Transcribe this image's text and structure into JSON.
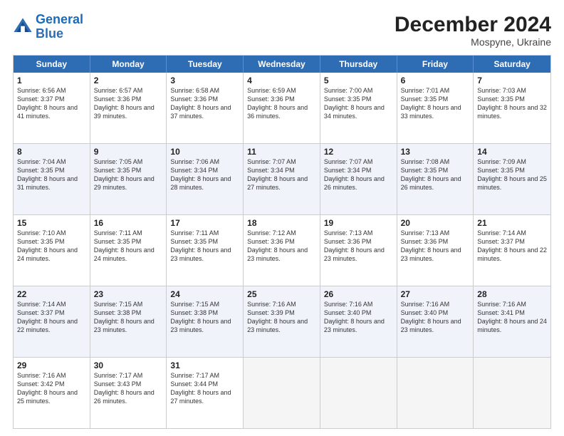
{
  "header": {
    "logo_line1": "General",
    "logo_line2": "Blue",
    "month_year": "December 2024",
    "location": "Mospyne, Ukraine"
  },
  "weekdays": [
    "Sunday",
    "Monday",
    "Tuesday",
    "Wednesday",
    "Thursday",
    "Friday",
    "Saturday"
  ],
  "weeks": [
    [
      {
        "day": "1",
        "rise": "6:56 AM",
        "set": "3:37 PM",
        "daylight": "8 hours and 41 minutes.",
        "alt": false,
        "empty": false
      },
      {
        "day": "2",
        "rise": "6:57 AM",
        "set": "3:36 PM",
        "daylight": "8 hours and 39 minutes.",
        "alt": false,
        "empty": false
      },
      {
        "day": "3",
        "rise": "6:58 AM",
        "set": "3:36 PM",
        "daylight": "8 hours and 37 minutes.",
        "alt": false,
        "empty": false
      },
      {
        "day": "4",
        "rise": "6:59 AM",
        "set": "3:36 PM",
        "daylight": "8 hours and 36 minutes.",
        "alt": false,
        "empty": false
      },
      {
        "day": "5",
        "rise": "7:00 AM",
        "set": "3:35 PM",
        "daylight": "8 hours and 34 minutes.",
        "alt": false,
        "empty": false
      },
      {
        "day": "6",
        "rise": "7:01 AM",
        "set": "3:35 PM",
        "daylight": "8 hours and 33 minutes.",
        "alt": false,
        "empty": false
      },
      {
        "day": "7",
        "rise": "7:03 AM",
        "set": "3:35 PM",
        "daylight": "8 hours and 32 minutes.",
        "alt": false,
        "empty": false
      }
    ],
    [
      {
        "day": "8",
        "rise": "7:04 AM",
        "set": "3:35 PM",
        "daylight": "8 hours and 31 minutes.",
        "alt": true,
        "empty": false
      },
      {
        "day": "9",
        "rise": "7:05 AM",
        "set": "3:35 PM",
        "daylight": "8 hours and 29 minutes.",
        "alt": true,
        "empty": false
      },
      {
        "day": "10",
        "rise": "7:06 AM",
        "set": "3:34 PM",
        "daylight": "8 hours and 28 minutes.",
        "alt": true,
        "empty": false
      },
      {
        "day": "11",
        "rise": "7:07 AM",
        "set": "3:34 PM",
        "daylight": "8 hours and 27 minutes.",
        "alt": true,
        "empty": false
      },
      {
        "day": "12",
        "rise": "7:07 AM",
        "set": "3:34 PM",
        "daylight": "8 hours and 26 minutes.",
        "alt": true,
        "empty": false
      },
      {
        "day": "13",
        "rise": "7:08 AM",
        "set": "3:35 PM",
        "daylight": "8 hours and 26 minutes.",
        "alt": true,
        "empty": false
      },
      {
        "day": "14",
        "rise": "7:09 AM",
        "set": "3:35 PM",
        "daylight": "8 hours and 25 minutes.",
        "alt": true,
        "empty": false
      }
    ],
    [
      {
        "day": "15",
        "rise": "7:10 AM",
        "set": "3:35 PM",
        "daylight": "8 hours and 24 minutes.",
        "alt": false,
        "empty": false
      },
      {
        "day": "16",
        "rise": "7:11 AM",
        "set": "3:35 PM",
        "daylight": "8 hours and 24 minutes.",
        "alt": false,
        "empty": false
      },
      {
        "day": "17",
        "rise": "7:11 AM",
        "set": "3:35 PM",
        "daylight": "8 hours and 23 minutes.",
        "alt": false,
        "empty": false
      },
      {
        "day": "18",
        "rise": "7:12 AM",
        "set": "3:36 PM",
        "daylight": "8 hours and 23 minutes.",
        "alt": false,
        "empty": false
      },
      {
        "day": "19",
        "rise": "7:13 AM",
        "set": "3:36 PM",
        "daylight": "8 hours and 23 minutes.",
        "alt": false,
        "empty": false
      },
      {
        "day": "20",
        "rise": "7:13 AM",
        "set": "3:36 PM",
        "daylight": "8 hours and 23 minutes.",
        "alt": false,
        "empty": false
      },
      {
        "day": "21",
        "rise": "7:14 AM",
        "set": "3:37 PM",
        "daylight": "8 hours and 22 minutes.",
        "alt": false,
        "empty": false
      }
    ],
    [
      {
        "day": "22",
        "rise": "7:14 AM",
        "set": "3:37 PM",
        "daylight": "8 hours and 22 minutes.",
        "alt": true,
        "empty": false
      },
      {
        "day": "23",
        "rise": "7:15 AM",
        "set": "3:38 PM",
        "daylight": "8 hours and 23 minutes.",
        "alt": true,
        "empty": false
      },
      {
        "day": "24",
        "rise": "7:15 AM",
        "set": "3:38 PM",
        "daylight": "8 hours and 23 minutes.",
        "alt": true,
        "empty": false
      },
      {
        "day": "25",
        "rise": "7:16 AM",
        "set": "3:39 PM",
        "daylight": "8 hours and 23 minutes.",
        "alt": true,
        "empty": false
      },
      {
        "day": "26",
        "rise": "7:16 AM",
        "set": "3:40 PM",
        "daylight": "8 hours and 23 minutes.",
        "alt": true,
        "empty": false
      },
      {
        "day": "27",
        "rise": "7:16 AM",
        "set": "3:40 PM",
        "daylight": "8 hours and 23 minutes.",
        "alt": true,
        "empty": false
      },
      {
        "day": "28",
        "rise": "7:16 AM",
        "set": "3:41 PM",
        "daylight": "8 hours and 24 minutes.",
        "alt": true,
        "empty": false
      }
    ],
    [
      {
        "day": "29",
        "rise": "7:16 AM",
        "set": "3:42 PM",
        "daylight": "8 hours and 25 minutes.",
        "alt": false,
        "empty": false
      },
      {
        "day": "30",
        "rise": "7:17 AM",
        "set": "3:43 PM",
        "daylight": "8 hours and 26 minutes.",
        "alt": false,
        "empty": false
      },
      {
        "day": "31",
        "rise": "7:17 AM",
        "set": "3:44 PM",
        "daylight": "8 hours and 27 minutes.",
        "alt": false,
        "empty": false
      },
      {
        "day": "",
        "rise": "",
        "set": "",
        "daylight": "",
        "alt": false,
        "empty": true
      },
      {
        "day": "",
        "rise": "",
        "set": "",
        "daylight": "",
        "alt": false,
        "empty": true
      },
      {
        "day": "",
        "rise": "",
        "set": "",
        "daylight": "",
        "alt": false,
        "empty": true
      },
      {
        "day": "",
        "rise": "",
        "set": "",
        "daylight": "",
        "alt": false,
        "empty": true
      }
    ]
  ]
}
